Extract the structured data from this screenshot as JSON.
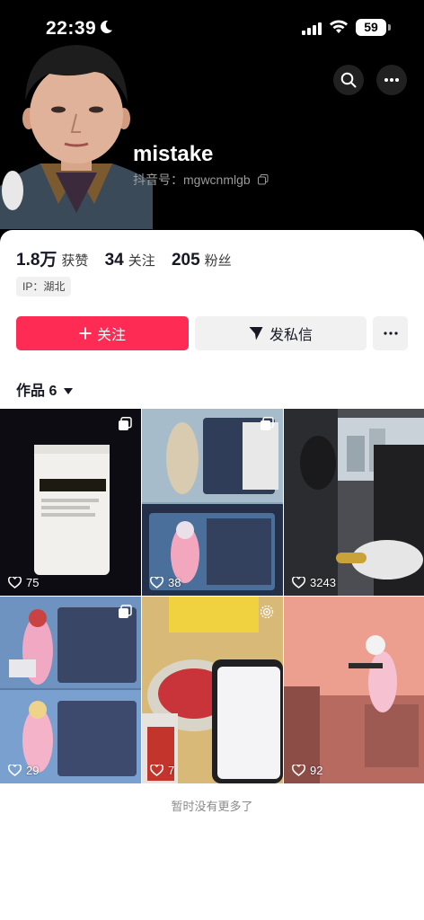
{
  "status_bar": {
    "time": "22:39",
    "battery": "59"
  },
  "profile": {
    "username": "mistake",
    "douyin_id": "抖音号：mgwcnmlgb",
    "stats": [
      {
        "value": "1.8万",
        "label": "获赞"
      },
      {
        "value": "34",
        "label": "关注"
      },
      {
        "value": "205",
        "label": "粉丝"
      }
    ],
    "ip": "IP：湖北"
  },
  "actions": {
    "follow": "关注",
    "message": "发私信"
  },
  "works": {
    "tab_label": "作品 6",
    "items": [
      {
        "likes": "75"
      },
      {
        "likes": "38"
      },
      {
        "likes": "3243"
      },
      {
        "likes": "29"
      },
      {
        "likes": "7"
      },
      {
        "likes": "92"
      }
    ]
  },
  "footer": {
    "no_more": "暂时没有更多了"
  },
  "colors": {
    "accent": "#fe2c55",
    "header_bg": "#000000",
    "chip_bg": "#f1f1f2"
  }
}
